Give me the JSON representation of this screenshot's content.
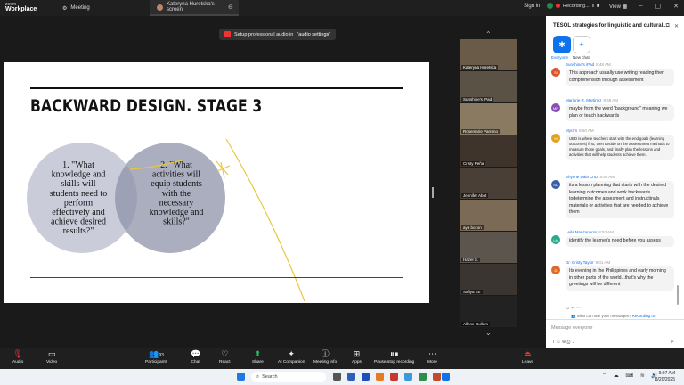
{
  "topbar": {
    "brand_line1": "zoom",
    "brand_line2": "Workplace",
    "tab_meeting": "Meeting",
    "tab_screen": "Kateryna Huretska's screen",
    "signin": "Sign in",
    "recording": "Recording...",
    "view": "View"
  },
  "banner": {
    "text": "Setup professional audio in",
    "link": "\"audio settings\""
  },
  "slide": {
    "title": "BACKWARD DESIGN. STAGE 3",
    "circle1": [
      "1. \"What",
      "knowledge and",
      "skills will",
      "students need to",
      "perform",
      "effectively and",
      "achieve desired",
      "results?\""
    ],
    "circle2": [
      "2. \"What",
      "activities will",
      "equip students",
      "with the",
      "necessary",
      "knowledge and",
      "skills?\""
    ]
  },
  "participants": [
    {
      "name": "Kateryna Huretska"
    },
    {
      "name": "Sunshine's iPad"
    },
    {
      "name": "Rosemarie Parreno"
    },
    {
      "name": "Cristy Peña"
    },
    {
      "name": "Jennifer Abot"
    },
    {
      "name": "aya bozon"
    },
    {
      "name": "Hazel S."
    },
    {
      "name": "Safiya ZE"
    },
    {
      "name": "Allene Gullem"
    }
  ],
  "chat": {
    "title": "TESOL strategies for linguistic and cultural...",
    "everyone": "Everyone",
    "new_chat": "New chat",
    "messages": [
      {
        "initials": "SI",
        "sender": "Sunshine's iPad",
        "time": "8:48 AM",
        "text": "This approach usually use writing reading then comprehension through assessment",
        "color": "#d9552e"
      },
      {
        "initials": "MR",
        "sender": "Marjorie R. Martinez",
        "time": "8:48 AM",
        "text": "maybe from the word \"background\" meaning we plan or teach backwards",
        "color": "#8a4fb5"
      },
      {
        "initials": "M",
        "sender": "Myra's",
        "time": "8:50 AM",
        "text": "UBD is where teachers start with the end goals (learning outcomes) first, then decide on the assessment methods to measure those goals, and finally plan the lessons and activities that will help students achieve them.",
        "color": "#e0a020"
      },
      {
        "initials": "SD",
        "sender": "Shynne Dala Cruz",
        "time": "8:50 AM",
        "text": "its a lesson planning that starts with the desired learning outcomes and work backwards todetermine the assesment and instructinals materials or activities that are needed to achieve them",
        "color": "#3a5fa8"
      },
      {
        "initials": "LM",
        "sender": "Leila Manzanerss",
        "time": "8:52 AM",
        "text": "identify the learner's need before you assess",
        "color": "#2aa88a"
      },
      {
        "initials": "D",
        "sender": "Dr. Cristy Taylor",
        "time": "9:01 AM",
        "text": "Its evening in the Philippines and early morning in other parts of the world...that's why the greetings will be different",
        "color": "#e06a2a"
      }
    ],
    "who_can_see": "Who can see your messages?",
    "recording_on": "Recording on",
    "placeholder": "Message everyone"
  },
  "toolbar": {
    "audio": "Audio",
    "video": "Video",
    "participants": "Participants",
    "participants_count": "93",
    "chat": "Chat",
    "react": "React",
    "share": "Share",
    "ai": "AI Companion",
    "meeting_info": "Meeting info",
    "apps": "Apps",
    "pause": "Pause/stop recording",
    "more": "More",
    "leave": "Leave"
  },
  "taskbar": {
    "search": "Search",
    "time": "9:07 AM",
    "date": "8/20/2025"
  }
}
